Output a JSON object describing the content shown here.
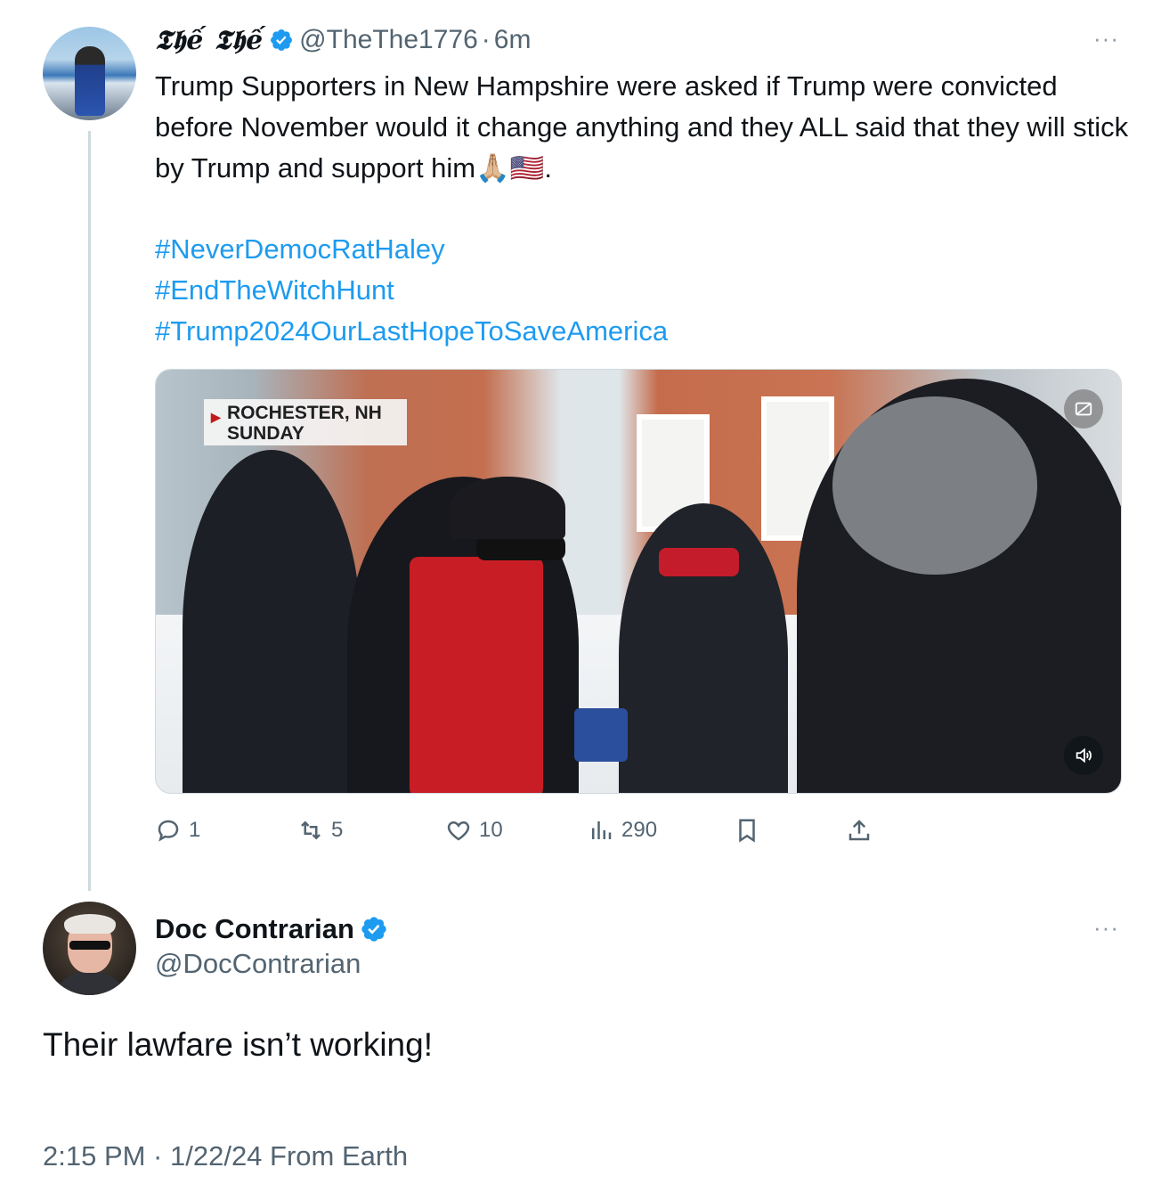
{
  "original_tweet": {
    "display_name": "𝕿𝖍ế 𝕿𝖍ế",
    "handle": "@TheThe1776",
    "separator": "·",
    "time": "6m",
    "verified": true,
    "more_label": "···",
    "text": "Trump Supporters in New Hampshire were asked if Trump were convicted before November would it change anything and they ALL said that they will stick by Trump and support him🙏🏼🇺🇸.",
    "hashtags": [
      "#NeverDemocRatHaley",
      "#EndTheWitchHunt",
      "#Trump2024OurLastHopeToSaveAmerica"
    ],
    "video": {
      "caption_line1": "ROCHESTER, NH",
      "caption_line2": "SUNDAY",
      "cc_icon": "closed-captions-icon",
      "mute_icon": "speaker-icon"
    },
    "actions": {
      "replies": "1",
      "retweets": "5",
      "likes": "10",
      "views": "290"
    }
  },
  "reply_tweet": {
    "display_name": "Doc Contrarian",
    "handle": "@DocContrarian",
    "verified": true,
    "more_label": "···",
    "text": "Their lawfare isn’t working!",
    "meta": "2:15 PM · 1/22/24 From Earth"
  },
  "colors": {
    "link": "#1d9bf0",
    "secondary_text": "#536471",
    "verified_badge": "#1d9bf0"
  }
}
